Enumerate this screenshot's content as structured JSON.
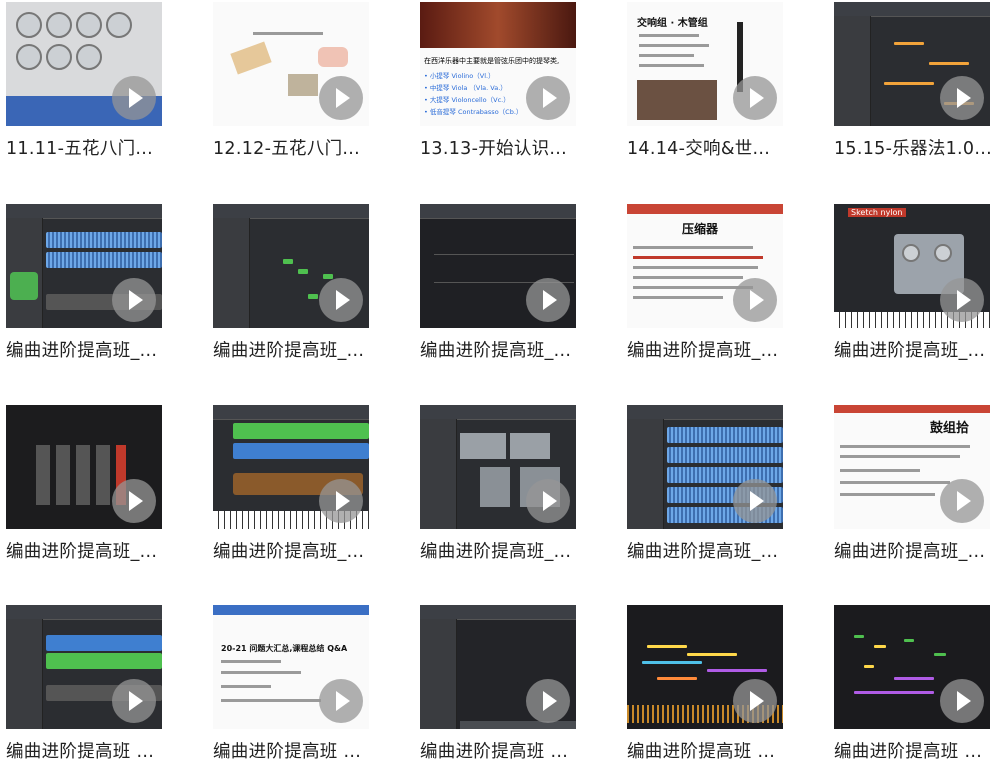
{
  "videos": [
    {
      "title": "11.11-五花八门..."
    },
    {
      "title": "12.12-五花八门..."
    },
    {
      "title": "13.13-开始认识..."
    },
    {
      "title": "14.14-交响&世..."
    },
    {
      "title": "15.15-乐器法1.0..."
    },
    {
      "title": "编曲进阶提高班_..."
    },
    {
      "title": "编曲进阶提高班_..."
    },
    {
      "title": "编曲进阶提高班_..."
    },
    {
      "title": "编曲进阶提高班_..."
    },
    {
      "title": "编曲进阶提高班_..."
    },
    {
      "title": "编曲进阶提高班_..."
    },
    {
      "title": "编曲进阶提高班_..."
    },
    {
      "title": "编曲进阶提高班_..."
    },
    {
      "title": "编曲进阶提高班_..."
    },
    {
      "title": "编曲进阶提高班_..."
    },
    {
      "title": "编曲进阶提高班 ..."
    },
    {
      "title": "编曲进阶提高班 ..."
    },
    {
      "title": "编曲进阶提高班 ..."
    },
    {
      "title": "编曲进阶提高班 ..."
    },
    {
      "title": "编曲进阶提高班 ..."
    }
  ],
  "thumb_text": {
    "t3_line1": "在西洋乐器中主要就是管弦乐团中的提琴类,",
    "t3_items": [
      "• 小提琴 Violino（Vl.）",
      "• 中提琴 Viola （Vla. Va.）",
      "• 大提琴 Violoncello（Vc.）",
      "• 低音提琴 Contrabasso（Cb.）"
    ],
    "t4_title": "交响组 · 木管组",
    "t9_title": "压缩器",
    "t10_label": "Sketch nylon",
    "t15_title": "鼓组拾",
    "t17_title": "20-21 问题大汇总,课程总结 Q&A"
  }
}
